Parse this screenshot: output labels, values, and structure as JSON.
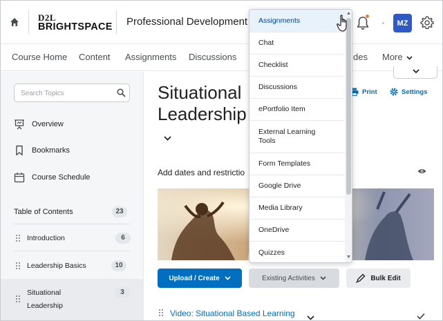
{
  "header": {
    "logo_line1": "D2L",
    "logo_line2": "BRIGHTSPACE",
    "course_title": "Professional Development",
    "avatar_initials": "MZ",
    "accent_color": "#006fbf",
    "avatar_color": "#2f59c3",
    "notification_color": "#f47a20"
  },
  "nav": {
    "items": [
      "Course Home",
      "Content",
      "Assignments",
      "Discussions",
      "des",
      "More"
    ]
  },
  "sidebar": {
    "search_placeholder": "Search Topics",
    "links": [
      "Overview",
      "Bookmarks",
      "Course Schedule"
    ],
    "toc_label": "Table of Contents",
    "toc_count": "23",
    "modules": [
      {
        "label": "Introduction",
        "count": "6"
      },
      {
        "label": "Leadership Basics",
        "count": "10"
      },
      {
        "label_line1": "Situational",
        "label_line2": "Leadership",
        "count": "3"
      }
    ]
  },
  "main": {
    "title_line1": "Situational",
    "title_line2": "Leadership",
    "print_label": "Print",
    "settings_label": "Settings",
    "add_dates_text": "Add dates and restrictio",
    "upload_label": "Upload / Create",
    "existing_label": "Existing Activities",
    "bulk_edit_label": "Bulk Edit",
    "first_item": "Video: Situational Based Learning"
  },
  "menu": {
    "items": [
      "Assignments",
      "Chat",
      "Checklist",
      "Discussions",
      "ePortfolio Item",
      "External Learning Tools",
      "Form Templates",
      "Google Drive",
      "Media Library",
      "OneDrive",
      "Quizzes"
    ],
    "highlighted_index": 0
  }
}
